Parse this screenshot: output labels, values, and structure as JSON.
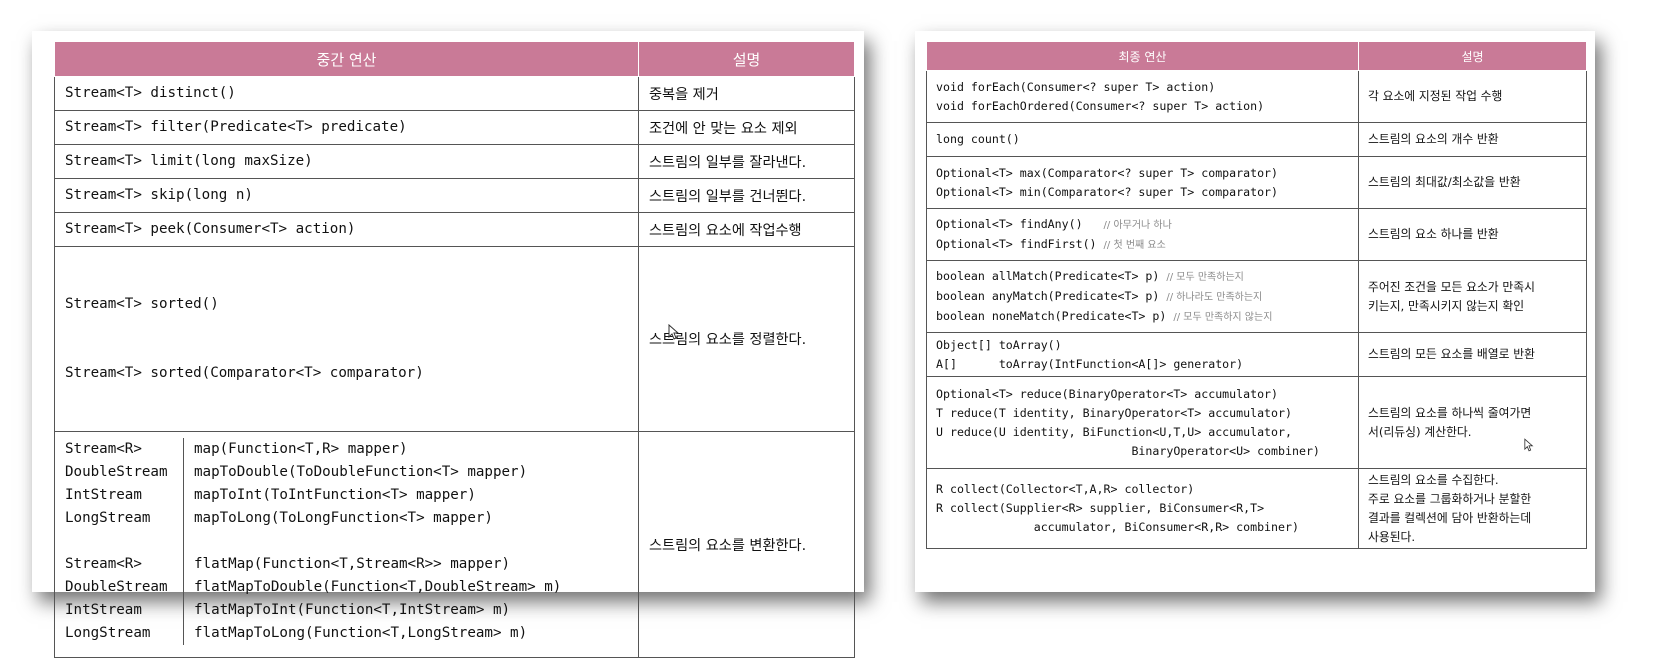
{
  "left": {
    "headers": [
      "중간 연산",
      "설명"
    ],
    "rows": [
      {
        "code": [
          "Stream<T> distinct()"
        ],
        "desc": "중복을 제거"
      },
      {
        "code": [
          "Stream<T> filter(Predicate<T> predicate)"
        ],
        "desc": "조건에 안 맞는 요소 제외"
      },
      {
        "code": [
          "Stream<T> limit(long maxSize)"
        ],
        "desc": "스트림의 일부를 잘라낸다."
      },
      {
        "code": [
          "Stream<T> skip(long n)"
        ],
        "desc": "스트림의 일부를 건너뛴다."
      },
      {
        "code": [
          "Stream<T> peek(Consumer<T> action)"
        ],
        "desc": "스트림의 요소에 작업수행"
      },
      {
        "code": [
          "Stream<T> sorted()",
          "Stream<T> sorted(Comparator<T> comparator)"
        ],
        "desc": "스트림의 요소를 정렬한다."
      }
    ],
    "map_rows": {
      "types": [
        "Stream<R>",
        "DoubleStream",
        "IntStream",
        "LongStream",
        "",
        "Stream<R>",
        "DoubleStream",
        "IntStream",
        "LongStream"
      ],
      "funcs": [
        "map(Function<T,R> mapper)",
        "mapToDouble(ToDoubleFunction<T> mapper)",
        "mapToInt(ToIntFunction<T> mapper)",
        "mapToLong(ToLongFunction<T> mapper)",
        "",
        "flatMap(Function<T,Stream<R>> mapper)",
        "flatMapToDouble(Function<T,DoubleStream> m)",
        "flatMapToInt(Function<T,IntStream> m)",
        "flatMapToLong(Function<T,LongStream> m)"
      ],
      "desc": "스트림의 요소를 변환한다."
    }
  },
  "right": {
    "headers": [
      "최종 연산",
      "설명"
    ],
    "rows": [
      {
        "code": [
          "void forEach(Consumer<? super T> action)",
          "void forEachOrdered(Consumer<? super T> action)"
        ],
        "comments": [
          "",
          ""
        ],
        "desc": [
          "각 요소에 지정된 작업 수행"
        ]
      },
      {
        "code": [
          "long count()"
        ],
        "comments": [
          ""
        ],
        "desc": [
          "스트림의 요소의 개수 반환"
        ]
      },
      {
        "code": [
          "Optional<T> max(Comparator<? super T> comparator)",
          "Optional<T> min(Comparator<? super T> comparator)"
        ],
        "comments": [
          "",
          ""
        ],
        "desc": [
          "스트림의 최대값/최소값을 반환"
        ]
      },
      {
        "code": [
          "Optional<T> findAny()   ",
          "Optional<T> findFirst() "
        ],
        "comments": [
          "// 아무거나 하나",
          "// 첫 번째 요소"
        ],
        "desc": [
          "스트림의 요소 하나를 반환"
        ]
      },
      {
        "code": [
          "boolean allMatch(Predicate<T> p) ",
          "boolean anyMatch(Predicate<T> p) ",
          "boolean noneMatch(Predicate<T> p) "
        ],
        "comments": [
          "// 모두 만족하는지",
          "// 하나라도 만족하는지",
          "// 모두 만족하지 않는지"
        ],
        "desc": [
          "주어진 조건을 모든 요소가 만족시",
          "키는지, 만족시키지 않는지 확인"
        ]
      },
      {
        "code": [
          "Object[] toArray()",
          "A[]      toArray(IntFunction<A[]> generator)"
        ],
        "comments": [
          "",
          ""
        ],
        "desc": [
          "스트림의 모든 요소를 배열로 반환"
        ]
      },
      {
        "code": [
          "Optional<T> reduce(BinaryOperator<T> accumulator)",
          "T reduce(T identity, BinaryOperator<T> accumulator)",
          "U reduce(U identity, BiFunction<U,T,U> accumulator,",
          "                            BinaryOperator<U> combiner)"
        ],
        "comments": [
          "",
          "",
          "",
          ""
        ],
        "desc": [
          "스트림의 요소를 하나씩 줄여가면",
          "서(리듀싱) 계산한다."
        ]
      },
      {
        "code": [
          "R collect(Collector<T,A,R> collector)",
          "R collect(Supplier<R> supplier, BiConsumer<R,T>",
          "              accumulator, BiConsumer<R,R> combiner)"
        ],
        "comments": [
          "",
          "",
          ""
        ],
        "desc": [
          "스트림의 요소를 수집한다.",
          "주로 요소를 그룹화하거나 분할한",
          "결과를 컬렉션에 담아 반환하는데",
          "사용된다."
        ]
      }
    ]
  },
  "colors": {
    "header_bg": "#c97a97",
    "header_text": "#ffffff",
    "border": "#555555"
  }
}
